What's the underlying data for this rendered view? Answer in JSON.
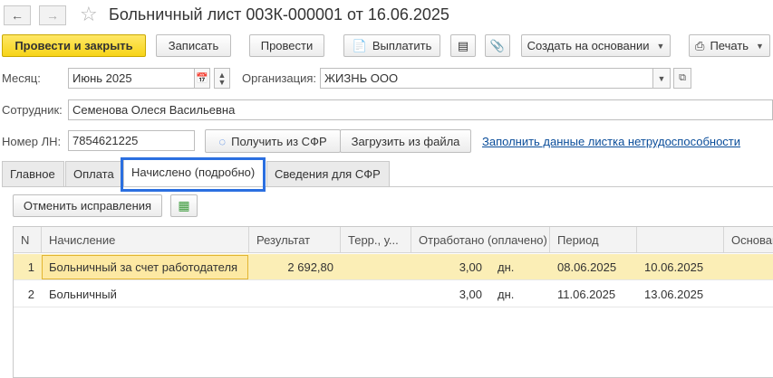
{
  "window": {
    "title": "Больничный лист 003К-000001 от 16.06.2025"
  },
  "toolbar": {
    "post_close": "Провести и закрыть",
    "save": "Записать",
    "post": "Провести",
    "pay": "Выплатить",
    "create_based": "Создать на основании",
    "print": "Печать"
  },
  "form": {
    "month_label": "Месяц:",
    "month_value": "Июнь 2025",
    "org_label": "Организация:",
    "org_value": "ЖИЗНЬ ООО",
    "employee_label": "Сотрудник:",
    "employee_value": "Семенова Олеся Васильевна",
    "ln_label": "Номер ЛН:",
    "ln_value": "7854621225",
    "get_sfr": "Получить из СФР",
    "load_file": "Загрузить из файла",
    "fill_link": "Заполнить данные листка нетрудоспособности"
  },
  "tabs": [
    {
      "label": "Главное"
    },
    {
      "label": "Оплата"
    },
    {
      "label": "Начислено (подробно)"
    },
    {
      "label": "Сведения для СФР"
    }
  ],
  "panel": {
    "cancel_fix": "Отменить исправления"
  },
  "table": {
    "columns": [
      "N",
      "Начисление",
      "Результат",
      "Терр., у...",
      "Отработано (оплачено)",
      "Период",
      "",
      "Основан"
    ],
    "rows": [
      {
        "n": "1",
        "accrual": "Больничный за счет работодателя",
        "result": "2 692,80",
        "terr": "",
        "worked": "3,00",
        "unit": "дн.",
        "period_start": "08.06.2025",
        "period_end": "10.06.2025"
      },
      {
        "n": "2",
        "accrual": "Больничный",
        "result": "",
        "terr": "",
        "worked": "3,00",
        "unit": "дн.",
        "period_start": "11.06.2025",
        "period_end": "13.06.2025"
      }
    ]
  },
  "colors": {
    "primary_button": "#f7d418",
    "tab_highlight": "#2b6fe0",
    "selected_row": "#fbeeb6",
    "link": "#0a4d9a"
  }
}
